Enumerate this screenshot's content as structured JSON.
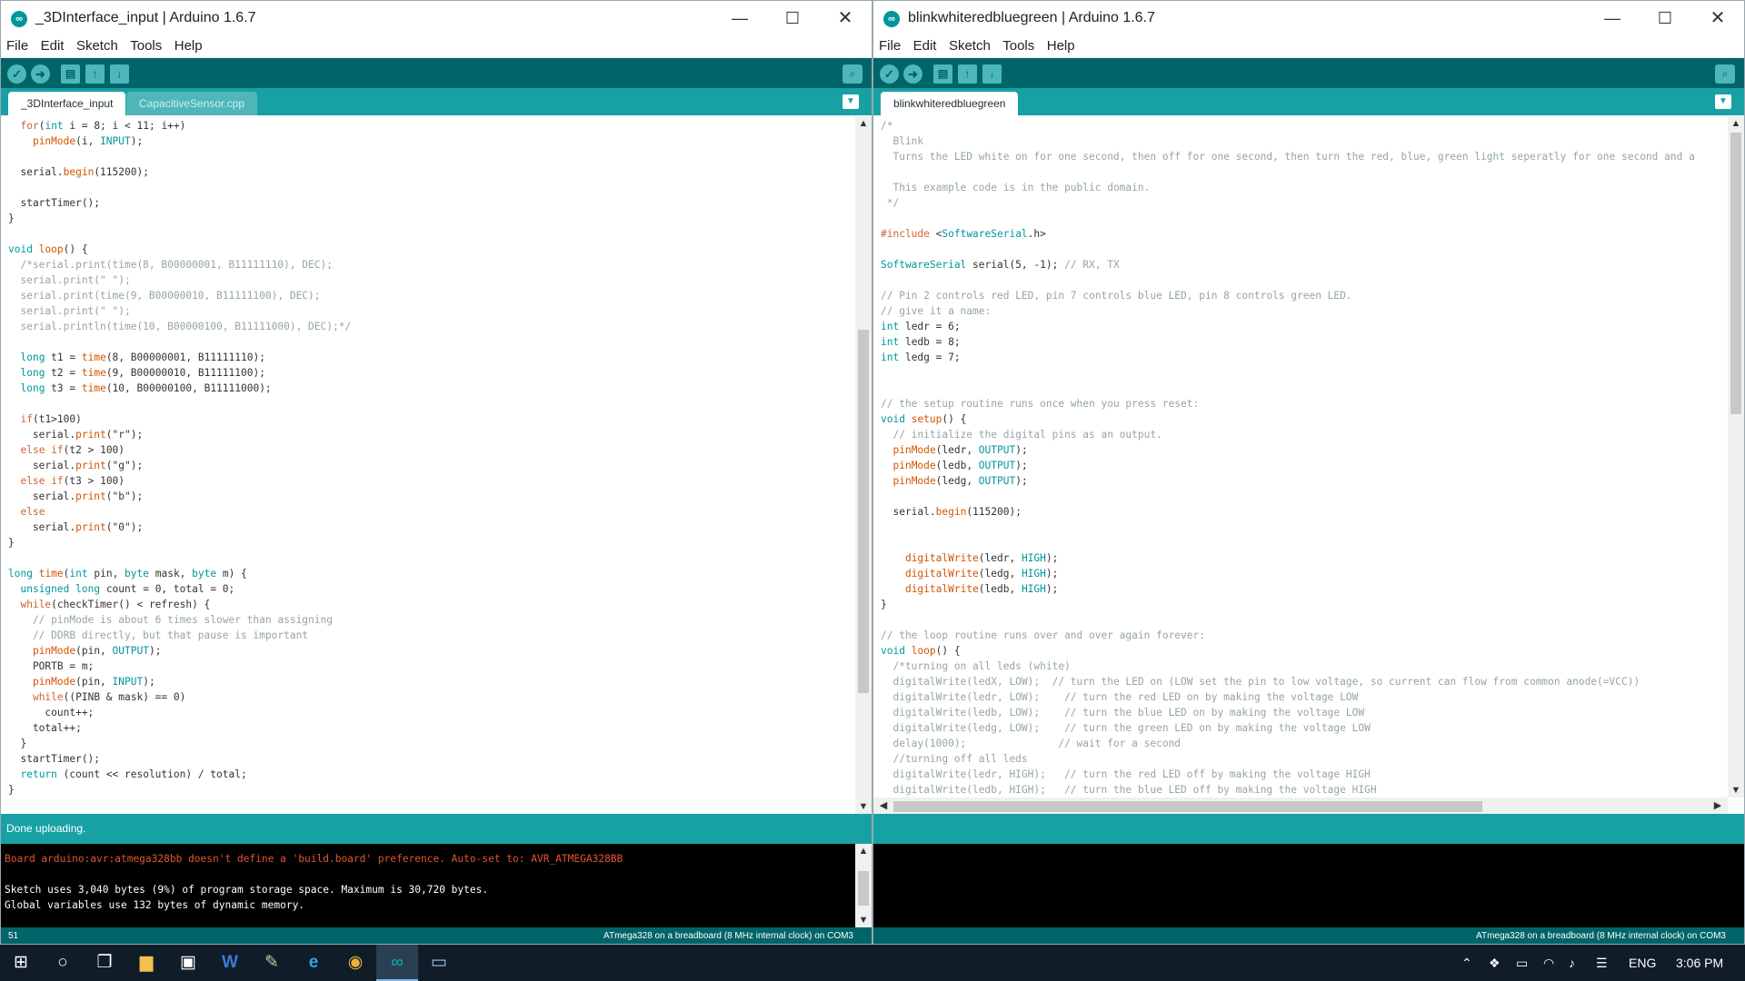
{
  "windows": [
    {
      "title": "_3DInterface_input | Arduino 1.6.7",
      "menu": [
        "File",
        "Edit",
        "Sketch",
        "Tools",
        "Help"
      ],
      "tabs": [
        "_3DInterface_input",
        "CapacitiveSensor.cpp"
      ],
      "status": "Done uploading.",
      "console": [
        "Board arduino:avr:atmega328bb doesn't define a 'build.board' preference. Auto-set to: AVR_ATMEGA328BB",
        "",
        "Sketch uses 3,040 bytes (9%) of program storage space. Maximum is 30,720 bytes.",
        "Global variables use 132 bytes of dynamic memory."
      ],
      "line_number": "51",
      "board": "ATmega328 on a breadboard (8 MHz internal clock) on COM3"
    },
    {
      "title": "blinkwhiteredbluegreen | Arduino 1.6.7",
      "menu": [
        "File",
        "Edit",
        "Sketch",
        "Tools",
        "Help"
      ],
      "tabs": [
        "blinkwhiteredbluegreen"
      ],
      "status": "",
      "console": [],
      "line_number": "",
      "board": "ATmega328 on a breadboard (8 MHz internal clock) on COM3"
    }
  ],
  "code_left": [
    "  for(int i = 8; i < 11; i++)",
    "    pinMode(i, INPUT);",
    "",
    "  serial.begin(115200);",
    "",
    "  startTimer();",
    "}",
    "",
    "void loop() {",
    "  /*serial.print(time(8, B00000001, B11111110), DEC);",
    "  serial.print(\" \");",
    "  serial.print(time(9, B00000010, B11111100), DEC);",
    "  serial.print(\" \");",
    "  serial.println(time(10, B00000100, B11111000), DEC);*/",
    "",
    "  long t1 = time(8, B00000001, B11111110);",
    "  long t2 = time(9, B00000010, B11111100);",
    "  long t3 = time(10, B00000100, B11111000);",
    "",
    "  if(t1>100)",
    "    serial.print(\"r\");",
    "  else if(t2 > 100)",
    "    serial.print(\"g\");",
    "  else if(t3 > 100)",
    "    serial.print(\"b\");",
    "  else",
    "    serial.print(\"0\");",
    "}",
    "",
    "long time(int pin, byte mask, byte m) {",
    "  unsigned long count = 0, total = 0;",
    "  while(checkTimer() < refresh) {",
    "    // pinMode is about 6 times slower than assigning",
    "    // DDRB directly, but that pause is important",
    "    pinMode(pin, OUTPUT);",
    "    PORTB = m;",
    "    pinMode(pin, INPUT);",
    "    while((PINB & mask) == 0)",
    "      count++;",
    "    total++;",
    "  }",
    "  startTimer();",
    "  return (count << resolution) / total;",
    "}"
  ],
  "code_right": [
    "/*",
    "  Blink",
    "  Turns the LED white on for one second, then off for one second, then turn the red, blue, green light seperatly for one second and a",
    "",
    "  This example code is in the public domain.",
    " */",
    "",
    "#include <SoftwareSerial.h>",
    "",
    "SoftwareSerial serial(5, -1); // RX, TX",
    "",
    "// Pin 2 controls red LED, pin 7 controls blue LED, pin 8 controls green LED.",
    "// give it a name:",
    "int ledr = 6;",
    "int ledb = 8;",
    "int ledg = 7;",
    "",
    "",
    "// the setup routine runs once when you press reset:",
    "void setup() {",
    "  // initialize the digital pins as an output.",
    "  pinMode(ledr, OUTPUT);",
    "  pinMode(ledb, OUTPUT);",
    "  pinMode(ledg, OUTPUT);",
    "",
    "  serial.begin(115200);",
    "",
    "",
    "    digitalWrite(ledr, HIGH);",
    "    digitalWrite(ledg, HIGH);",
    "    digitalWrite(ledb, HIGH);",
    "}",
    "",
    "// the loop routine runs over and over again forever:",
    "void loop() {",
    "  /*turning on all leds (white)",
    "  digitalWrite(ledX, LOW);  // turn the LED on (LOW set the pin to low voltage, so current can flow from common anode(=VCC))",
    "  digitalWrite(ledr, LOW);    // turn the red LED on by making the voltage LOW",
    "  digitalWrite(ledb, LOW);    // turn the blue LED on by making the voltage LOW",
    "  digitalWrite(ledg, LOW);    // turn the green LED on by making the voltage LOW",
    "  delay(1000);               // wait for a second",
    "  //turning off all leds",
    "  digitalWrite(ledr, HIGH);   // turn the red LED off by making the voltage HIGH",
    "  digitalWrite(ledb, HIGH);   // turn the blue LED off by making the voltage HIGH"
  ],
  "taskbar": {
    "language": "ENG",
    "time": "3:06 PM",
    "icons": [
      "windows-start-icon",
      "cortana-icon",
      "task-view-icon",
      "file-explorer-icon",
      "store-icon",
      "word-icon",
      "notepad-icon",
      "edge-icon",
      "chrome-icon",
      "arduino-icon",
      "app-window-icon"
    ]
  },
  "colors": {
    "toolbar": "#006468",
    "tabsbar": "#17a1a5",
    "keyword": "#cc6633",
    "type": "#00979c",
    "comment": "#95a5a6",
    "error": "#e0552e"
  }
}
